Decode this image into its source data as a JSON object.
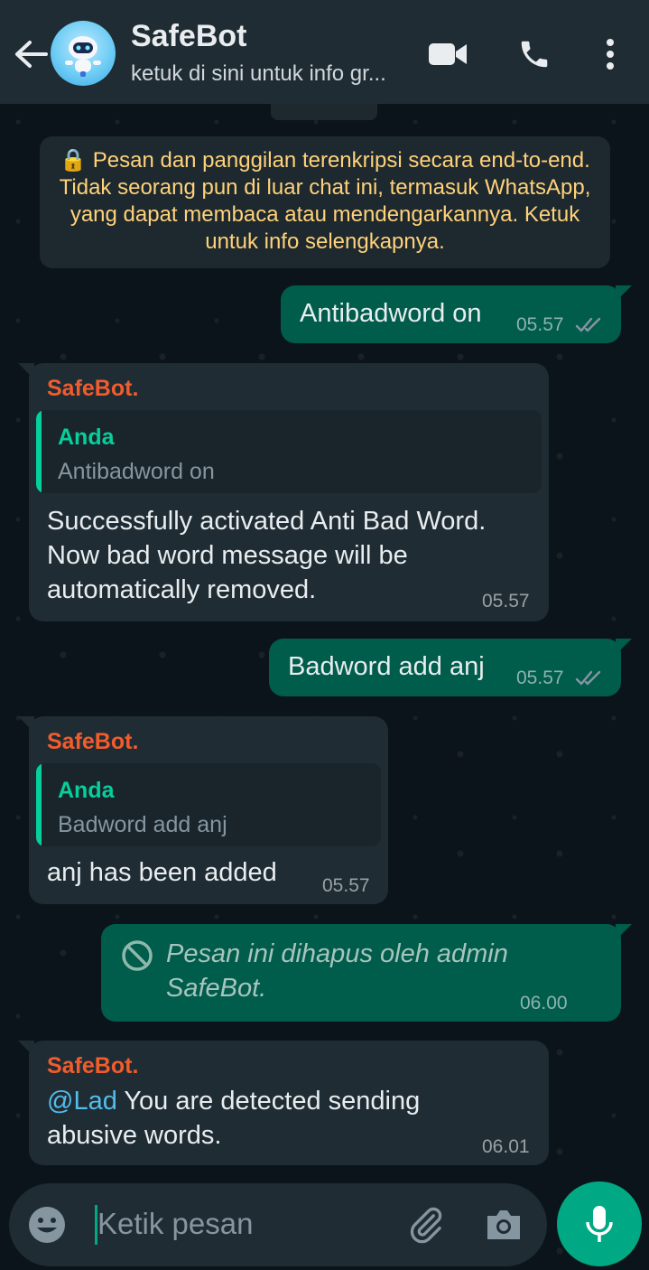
{
  "header": {
    "title": "SafeBot",
    "subtitle": "ketuk di sini untuk info gr..."
  },
  "system_notice": "🔒 Pesan dan panggilan terenkripsi secara end-to-end. Tidak seorang pun di luar chat ini, termasuk WhatsApp, yang dapat membaca atau mendengarkannya. Ketuk untuk info selengkapnya.",
  "messages": [
    {
      "text": "Antibadword on",
      "time": "05.57"
    },
    {
      "sender": "SafeBot.",
      "quote_name": "Anda",
      "quote_text": "Antibadword on",
      "text": "Successfully activated Anti Bad Word. Now bad word message will be automatically removed.",
      "time": "05.57"
    },
    {
      "text": "Badword add anj",
      "time": "05.57"
    },
    {
      "sender": "SafeBot.",
      "quote_name": "Anda",
      "quote_text": "Badword add anj",
      "text": "anj has been added",
      "time": "05.57"
    },
    {
      "text": "Pesan ini dihapus oleh admin SafeBot.",
      "time": "06.00"
    },
    {
      "sender": "SafeBot.",
      "mention": "@Lad",
      "text": " You are detected sending abusive words.",
      "time": "06.01"
    }
  ],
  "input": {
    "placeholder": "Ketik pesan"
  },
  "colors": {
    "header": "#1f2c34",
    "outgoing": "#005c4b",
    "incoming": "#1f2c34",
    "sender": "#f15c2c",
    "quote_name": "#06cf9c",
    "accent": "#00a884",
    "notice_text": "#ffd279",
    "mention": "#53bdeb"
  }
}
